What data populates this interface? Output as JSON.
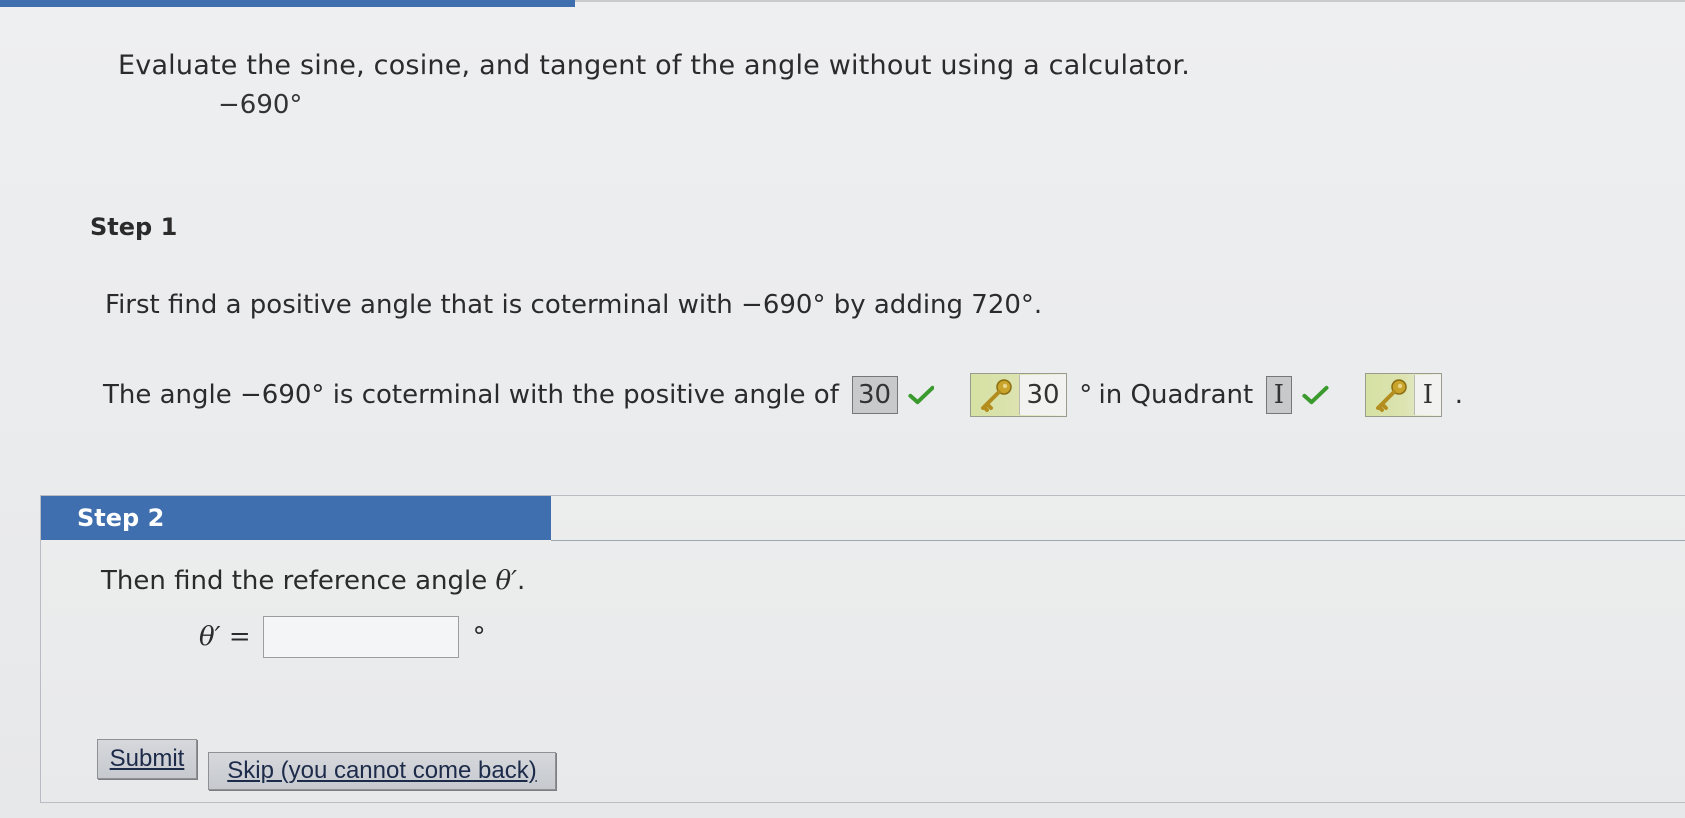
{
  "question": {
    "prompt": "Evaluate the sine, cosine, and tangent of the angle without using a calculator.",
    "angle": "−690°"
  },
  "step1": {
    "label": "Step 1",
    "instruction": "First find a positive angle that is coterminal with −690° by adding 720°.",
    "sentence_start": "The angle −690° is coterminal with the positive angle of",
    "answer_angle": "30",
    "correct_angle": "30",
    "degree_symbol": "°",
    "quadrant_text": "in Quadrant",
    "answer_quadrant": "I",
    "correct_quadrant": "I",
    "end_punct": "."
  },
  "step2": {
    "label": "Step 2",
    "instruction_prefix": "Then find the reference angle",
    "theta_symbol": "θ′",
    "instruction_suffix": ".",
    "equation_lhs": "θ′ =",
    "input_value": "",
    "degree_symbol": "°"
  },
  "buttons": {
    "submit": "Submit",
    "skip": "Skip (you cannot come back)"
  },
  "colors": {
    "header_blue": "#3f6fae",
    "check_green": "#3b9a2e",
    "key_gold": "#c9a42a"
  },
  "icons": {
    "correct": "check-icon",
    "answer_key": "key-icon"
  }
}
